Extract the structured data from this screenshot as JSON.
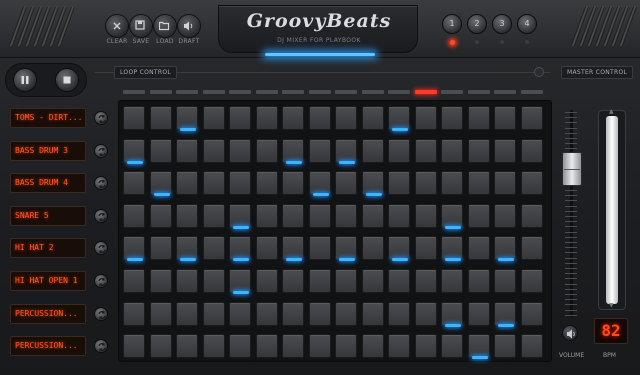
{
  "app": {
    "logo": "GroovyBeats",
    "subtitle": "DJ MIXER FOR PLAYBOOK"
  },
  "toolbar": [
    {
      "id": "clear",
      "label": "CLEAR",
      "icon": "clear-icon"
    },
    {
      "id": "save",
      "label": "SAVE",
      "icon": "save-icon"
    },
    {
      "id": "load",
      "label": "LOAD",
      "icon": "folder-icon"
    },
    {
      "id": "draft",
      "label": "DRAFT",
      "icon": "speaker-icon"
    }
  ],
  "presets": [
    {
      "label": "1",
      "active": true
    },
    {
      "label": "2",
      "active": false
    },
    {
      "label": "3",
      "active": false
    },
    {
      "label": "4",
      "active": false
    }
  ],
  "sections": {
    "loop": "LOOP CONTROL",
    "master": "MASTER CONTROL"
  },
  "transport": {
    "pause_icon": "pause-icon",
    "stop_icon": "stop-icon"
  },
  "current_step": 11,
  "tracks": [
    {
      "name": "TOMS - DIRT...",
      "steps": [
        0,
        0,
        1,
        0,
        0,
        0,
        0,
        0,
        0,
        0,
        1,
        0,
        0,
        0,
        0,
        0
      ]
    },
    {
      "name": "BASS DRUM 3",
      "steps": [
        1,
        0,
        0,
        0,
        0,
        0,
        1,
        0,
        1,
        0,
        0,
        0,
        0,
        0,
        0,
        0
      ]
    },
    {
      "name": "BASS DRUM 4",
      "steps": [
        0,
        1,
        0,
        0,
        0,
        0,
        0,
        1,
        0,
        1,
        0,
        0,
        0,
        0,
        0,
        0
      ]
    },
    {
      "name": "SNARE 5",
      "steps": [
        0,
        0,
        0,
        0,
        1,
        0,
        0,
        0,
        0,
        0,
        0,
        0,
        1,
        0,
        0,
        0
      ]
    },
    {
      "name": "HI HAT 2",
      "steps": [
        1,
        0,
        1,
        0,
        1,
        0,
        1,
        0,
        1,
        0,
        1,
        0,
        1,
        0,
        1,
        0
      ]
    },
    {
      "name": "HI HAT OPEN 1",
      "steps": [
        0,
        0,
        0,
        0,
        1,
        0,
        0,
        0,
        0,
        0,
        0,
        0,
        0,
        0,
        0,
        0
      ]
    },
    {
      "name": "PERCUSSION...",
      "steps": [
        0,
        0,
        0,
        0,
        0,
        0,
        0,
        0,
        0,
        0,
        0,
        0,
        1,
        0,
        1,
        0
      ]
    },
    {
      "name": "PERCUSSION...",
      "steps": [
        0,
        0,
        0,
        0,
        0,
        0,
        0,
        0,
        0,
        0,
        0,
        0,
        0,
        1,
        0,
        0
      ]
    }
  ],
  "master": {
    "volume_label": "VOLUME",
    "bpm_label": "BPM",
    "bpm_value": "82",
    "volume_level": 0.8
  },
  "colors": {
    "accent": "#3ab6ff",
    "led": "#ff4a2a",
    "display": "#ff5a24"
  }
}
